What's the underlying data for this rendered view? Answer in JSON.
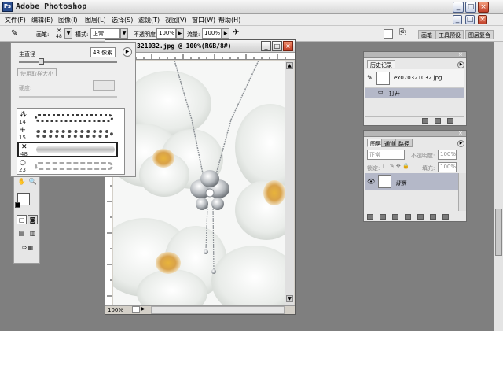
{
  "window": {
    "app_title": "Adobe Photoshop"
  },
  "menu": [
    "文件(F)",
    "编辑(E)",
    "图像(I)",
    "图层(L)",
    "选择(S)",
    "滤镜(T)",
    "视图(V)",
    "窗口(W)",
    "帮助(H)"
  ],
  "options_bar": {
    "brush_label": "画笔:",
    "brush_size": "48",
    "mode_label": "模式:",
    "mode_value": "正常",
    "opacity_label": "不透明度:",
    "opacity_value": "100%",
    "flow_label": "流量:",
    "flow_value": "100%",
    "well_tabs": [
      "画笔",
      "工具预设",
      "图层复合"
    ]
  },
  "brush_panel": {
    "diameter_label": "主直径",
    "diameter_value": "48 像素",
    "sample_button": "使用取样大小",
    "hardness_label": "硬度:",
    "brushes": [
      {
        "number": "14",
        "color": "#3a3a3a"
      },
      {
        "number": "15",
        "color": "#4a4a4a"
      },
      {
        "number": "48",
        "color": "#b8b8b8"
      },
      {
        "number": "23",
        "color": "#a8a8a8"
      }
    ]
  },
  "document": {
    "title": "321032.jpg @ 100%(RGB/8#)",
    "zoom": "100%"
  },
  "history_palette": {
    "tab": "历史记录",
    "snapshot_name": "ex070321032.jpg",
    "step_open": "打开"
  },
  "layers_palette": {
    "tabs": [
      "图层",
      "通道",
      "路径"
    ],
    "blend_mode": "正常",
    "opacity_label": "不透明度:",
    "opacity_value": "100%",
    "lock_label": "锁定:",
    "fill_label": "填充:",
    "fill_value": "100%",
    "layer_name": "背景"
  }
}
